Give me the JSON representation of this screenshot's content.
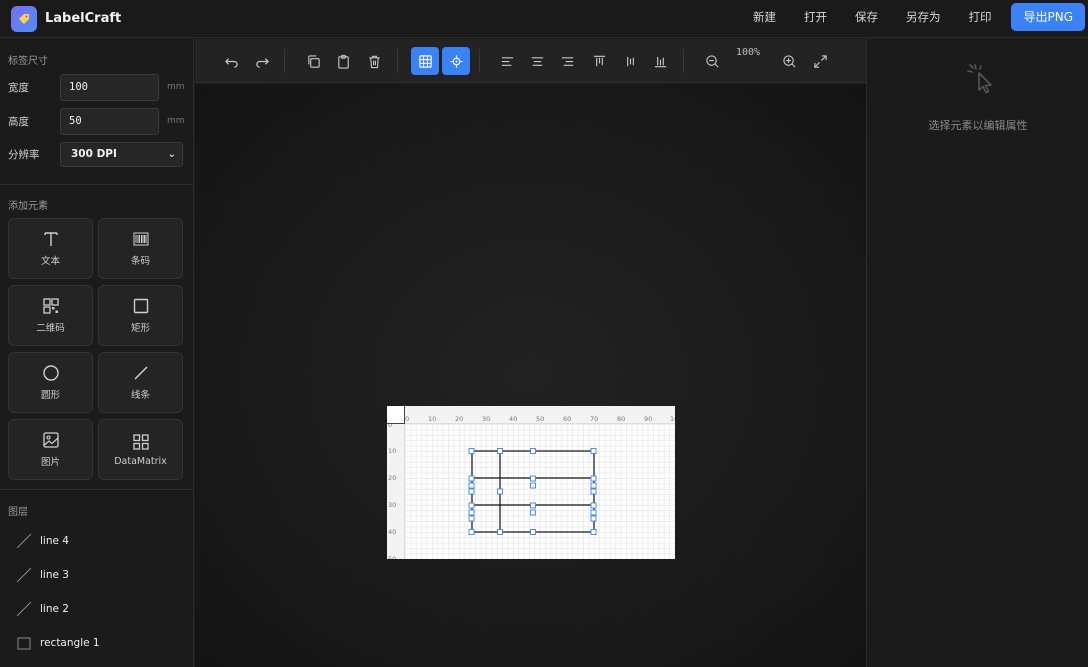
{
  "app": {
    "title": "LabelCraft"
  },
  "header": {
    "actions": [
      {
        "label": "新建"
      },
      {
        "label": "打开"
      },
      {
        "label": "保存"
      },
      {
        "label": "另存为"
      },
      {
        "label": "打印"
      }
    ],
    "export_label": "导出PNG"
  },
  "label_size": {
    "section_title": "标签尺寸",
    "width_label": "宽度",
    "width_value": "100",
    "width_unit": "mm",
    "height_label": "高度",
    "height_value": "50",
    "height_unit": "mm",
    "resolution_label": "分辨率",
    "resolution_value": "300 DPI"
  },
  "add_elements": {
    "section_title": "添加元素",
    "tools": [
      {
        "label": "文本",
        "icon": "text-icon"
      },
      {
        "label": "条码",
        "icon": "barcode-icon"
      },
      {
        "label": "二维码",
        "icon": "qrcode-icon"
      },
      {
        "label": "矩形",
        "icon": "rectangle-icon"
      },
      {
        "label": "圆形",
        "icon": "circle-icon"
      },
      {
        "label": "线条",
        "icon": "line-icon"
      },
      {
        "label": "图片",
        "icon": "image-icon"
      },
      {
        "label": "DataMatrix",
        "icon": "datamatrix-icon"
      }
    ]
  },
  "layers": {
    "section_title": "图层",
    "items": [
      {
        "label": "line 4",
        "icon": "line-icon"
      },
      {
        "label": "line 3",
        "icon": "line-icon"
      },
      {
        "label": "line 2",
        "icon": "line-icon"
      },
      {
        "label": "rectangle 1",
        "icon": "rectangle-icon"
      }
    ]
  },
  "toolbar": {
    "zoom": "100%",
    "grid_enabled": true,
    "snap_enabled": true,
    "accent_color": "#3b82f6"
  },
  "canvas": {
    "ruler_top": [
      "0",
      "10",
      "20",
      "30",
      "40",
      "50",
      "60",
      "70",
      "80",
      "90",
      "10"
    ],
    "ruler_left": [
      "0",
      "10",
      "20",
      "30",
      "40",
      "50"
    ]
  },
  "properties": {
    "empty_text": "选择元素以编辑属性"
  }
}
